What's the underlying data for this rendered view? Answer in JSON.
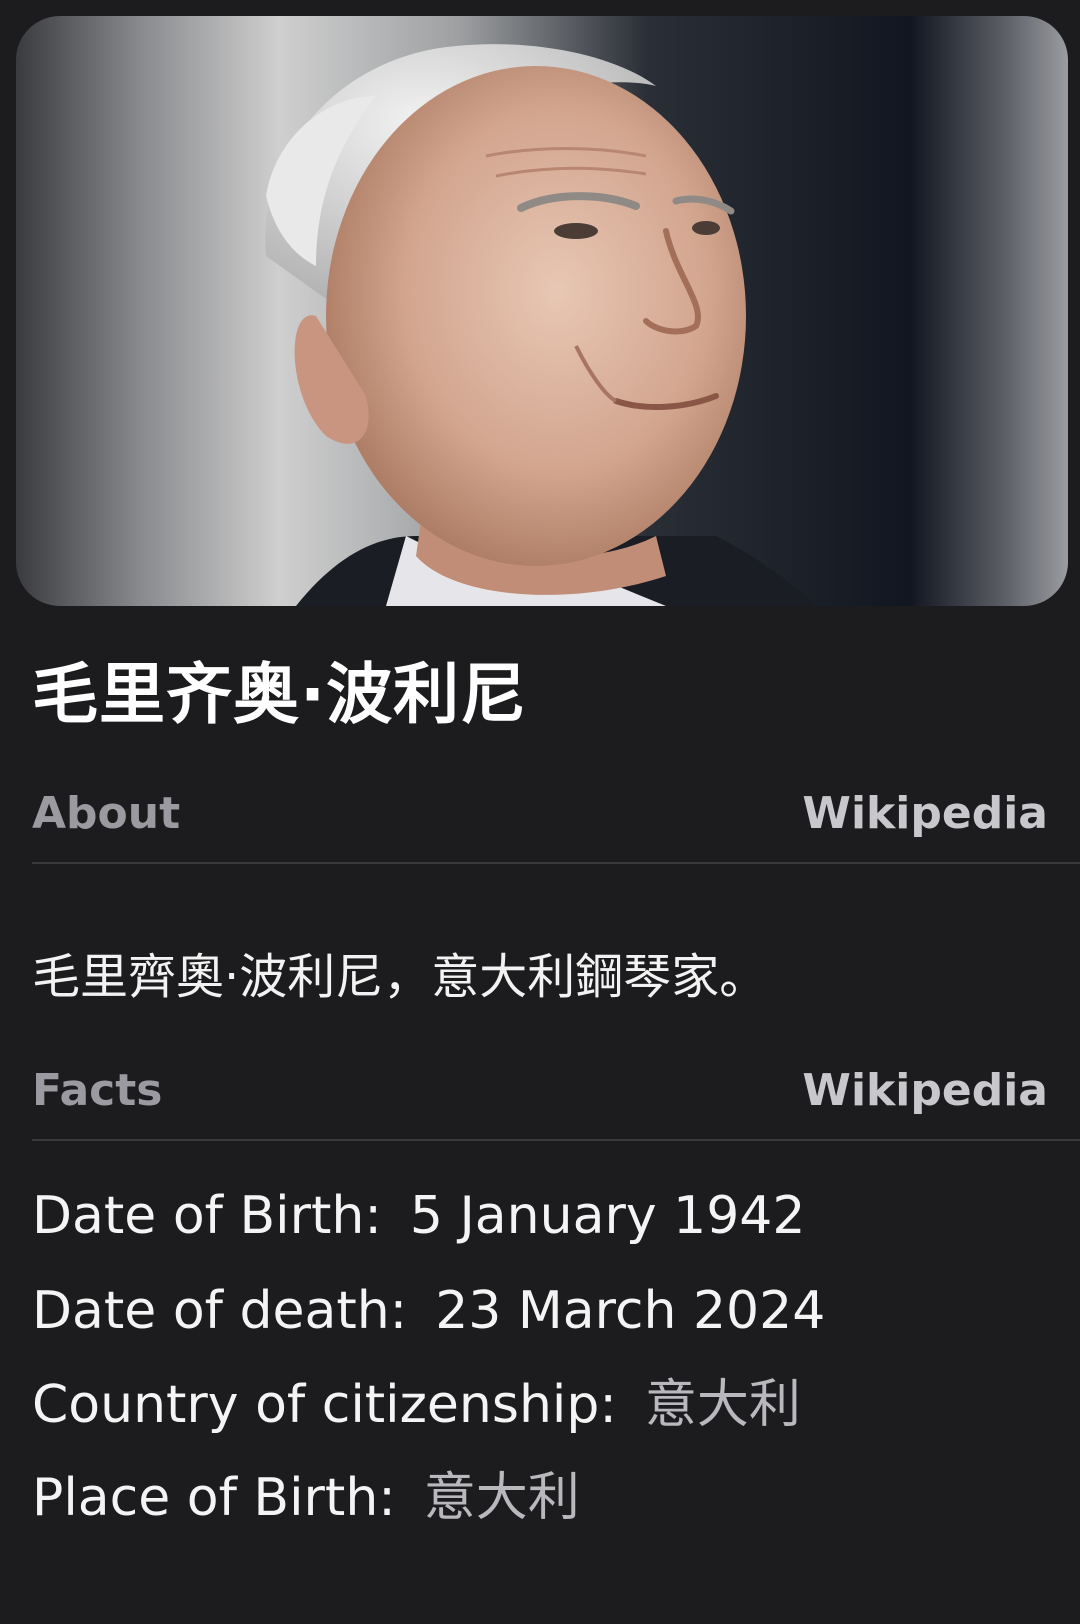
{
  "person": {
    "name": "毛里齐奥·波利尼"
  },
  "about": {
    "label": "About",
    "source": "Wikipedia",
    "text": "毛里齊奧·波利尼，意大利鋼琴家。"
  },
  "facts": {
    "label": "Facts",
    "source": "Wikipedia",
    "items": [
      {
        "key": "Date of Birth:",
        "value": "5 January 1942"
      },
      {
        "key": "Date of death:",
        "value": "23 March 2024"
      },
      {
        "key": "Country of citizenship:",
        "value": "意大利"
      },
      {
        "key": "Place of Birth:",
        "value": "意大利"
      }
    ]
  },
  "colors": {
    "background": "#1c1c1e",
    "header_label": "#9a9aa0",
    "divider": "#3a3a3e"
  }
}
